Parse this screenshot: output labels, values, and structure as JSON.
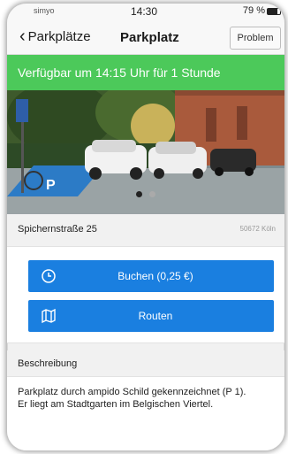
{
  "status_bar": {
    "carrier": "simyo",
    "time": "14:30",
    "battery": "79 %"
  },
  "nav": {
    "back_label": "Parkplätze",
    "title": "Parkplatz",
    "problem_label": "Problem"
  },
  "banner": {
    "text": "Verfügbar um 14:15 Uhr für 1 Stunde",
    "color": "#4cc95a"
  },
  "photo": {
    "page_count": 2,
    "active_page": 1
  },
  "address": {
    "street": "Spichernstraße 25",
    "zip_city": "50672 Köln"
  },
  "actions": {
    "book_label": "Buchen (0,25 €)",
    "book_icon": "clock-icon",
    "route_label": "Routen",
    "route_icon": "map-icon",
    "accent": "#1a7fe0"
  },
  "description": {
    "heading": "Beschreibung",
    "text": "Parkplatz durch ampido Schild gekennzeichnet (P 1). Er liegt am Stadtgarten im Belgischen Viertel."
  }
}
